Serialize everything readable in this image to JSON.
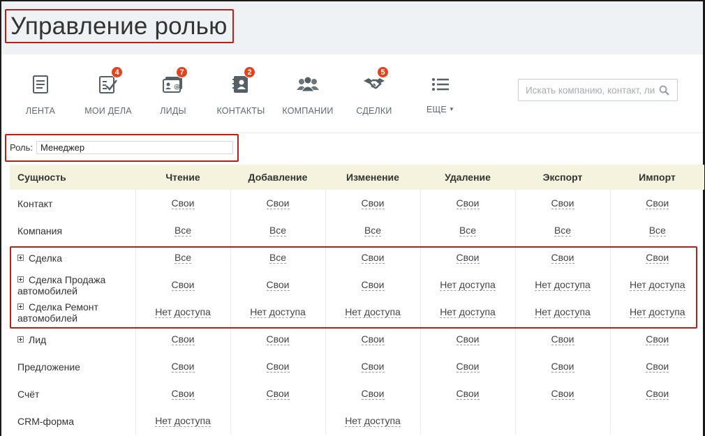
{
  "page": {
    "title": "Управление ролью"
  },
  "toolbar": {
    "items": [
      {
        "label": "ЛЕНТА",
        "icon": "feed-icon",
        "badge": ""
      },
      {
        "label": "МОИ ДЕЛА",
        "icon": "tasks-icon",
        "badge": "4"
      },
      {
        "label": "ЛИДЫ",
        "icon": "leads-icon",
        "badge": "7"
      },
      {
        "label": "КОНТАКТЫ",
        "icon": "contacts-icon",
        "badge": "2"
      },
      {
        "label": "КОМПАНИИ",
        "icon": "companies-icon",
        "badge": ""
      },
      {
        "label": "СДЕЛКИ",
        "icon": "deals-icon",
        "badge": "5"
      },
      {
        "label": "ЕЩЕ",
        "icon": "more-menu-icon",
        "badge": ""
      }
    ],
    "badge_color": "#e2451e",
    "search_placeholder": "Искать компанию, контакт, лид"
  },
  "role": {
    "label": "Роль:",
    "value": "Менеджер"
  },
  "table": {
    "headers": [
      "Сущность",
      "Чтение",
      "Добавление",
      "Изменение",
      "Удаление",
      "Экспорт",
      "Импорт"
    ],
    "rows": [
      {
        "entity": "Контакт",
        "expandable": false,
        "cells": [
          "Свои",
          "Свои",
          "Свои",
          "Свои",
          "Свои",
          "Свои"
        ]
      },
      {
        "entity": "Компания",
        "expandable": false,
        "cells": [
          "Все",
          "Все",
          "Все",
          "Все",
          "Все",
          "Все"
        ]
      },
      {
        "entity": "Сделка",
        "expandable": true,
        "cells": [
          "Все",
          "Все",
          "Свои",
          "Свои",
          "Свои",
          "Свои"
        ]
      },
      {
        "entity": "Сделка Продажа автомобилей",
        "expandable": true,
        "cells": [
          "Свои",
          "Свои",
          "Свои",
          "Нет доступа",
          "Нет доступа",
          "Нет доступа"
        ]
      },
      {
        "entity": "Сделка Ремонт автомобилей",
        "expandable": true,
        "cells": [
          "Нет доступа",
          "Нет доступа",
          "Нет доступа",
          "Нет доступа",
          "Нет доступа",
          "Нет доступа"
        ]
      },
      {
        "entity": "Лид",
        "expandable": true,
        "cells": [
          "Свои",
          "Свои",
          "Свои",
          "Свои",
          "Свои",
          "Свои"
        ]
      },
      {
        "entity": "Предложение",
        "expandable": false,
        "cells": [
          "Свои",
          "Свои",
          "Свои",
          "Свои",
          "Свои",
          "Свои"
        ]
      },
      {
        "entity": "Счёт",
        "expandable": false,
        "cells": [
          "Свои",
          "Свои",
          "Свои",
          "Свои",
          "Свои",
          "Свои"
        ]
      },
      {
        "entity": "CRM-форма",
        "expandable": false,
        "cells": [
          "Нет доступа",
          "",
          "Нет доступа",
          "",
          "",
          ""
        ]
      }
    ]
  },
  "colors": {
    "highlight": "#b5201d",
    "header_bg": "#eef2f4",
    "table_header_bg": "#f5f3dd"
  }
}
